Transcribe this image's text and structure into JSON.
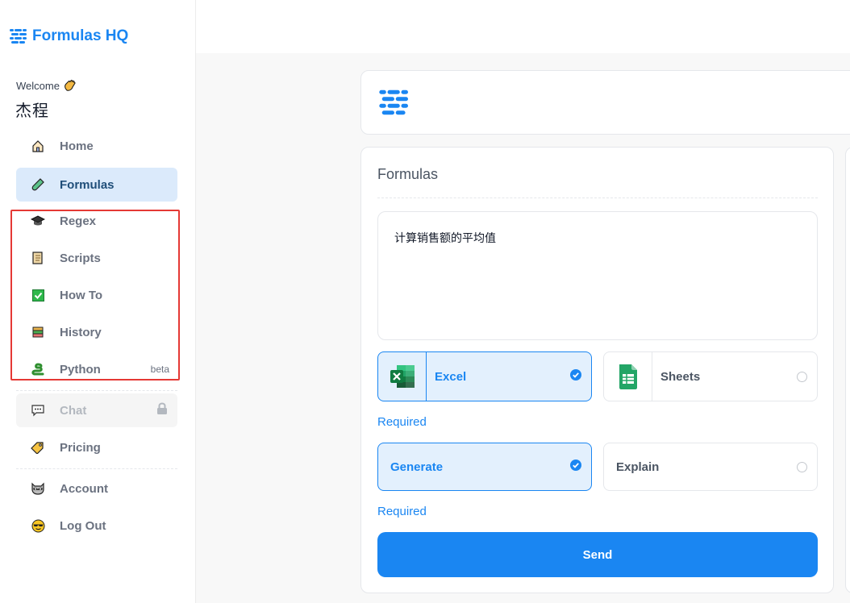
{
  "brand": {
    "name": "Formulas HQ"
  },
  "sidebar": {
    "welcome": "Welcome",
    "username": "杰程",
    "items": [
      {
        "label": "Home",
        "icon": "house-icon"
      },
      {
        "label": "Formulas",
        "icon": "test-tube-icon",
        "active": true
      },
      {
        "label": "Regex",
        "icon": "graduation-cap-icon"
      },
      {
        "label": "Scripts",
        "icon": "scroll-icon"
      },
      {
        "label": "How To",
        "icon": "check-box-icon"
      },
      {
        "label": "History",
        "icon": "books-icon"
      },
      {
        "label": "Python",
        "icon": "snake-icon",
        "badge": "beta"
      },
      {
        "label": "Chat",
        "icon": "speech-bubble-icon",
        "disabled": true
      },
      {
        "label": "Pricing",
        "icon": "price-tag-icon"
      },
      {
        "label": "Account",
        "icon": "raccoon-face-icon"
      },
      {
        "label": "Log Out",
        "icon": "sunglasses-face-icon"
      }
    ]
  },
  "main": {
    "title": "Formulas",
    "prompt_value": "计算销售额的平均值",
    "platform_options": [
      {
        "label": "Excel",
        "icon": "excel-icon",
        "selected": true
      },
      {
        "label": "Sheets",
        "icon": "sheets-icon",
        "selected": false
      }
    ],
    "platform_required": "Required",
    "mode_options": [
      {
        "label": "Generate",
        "selected": true
      },
      {
        "label": "Explain",
        "selected": false
      }
    ],
    "mode_required": "Required",
    "send_label": "Send"
  },
  "colors": {
    "accent": "#1a86f2",
    "active_bg": "#dbeafb",
    "highlight": "#e53935"
  }
}
